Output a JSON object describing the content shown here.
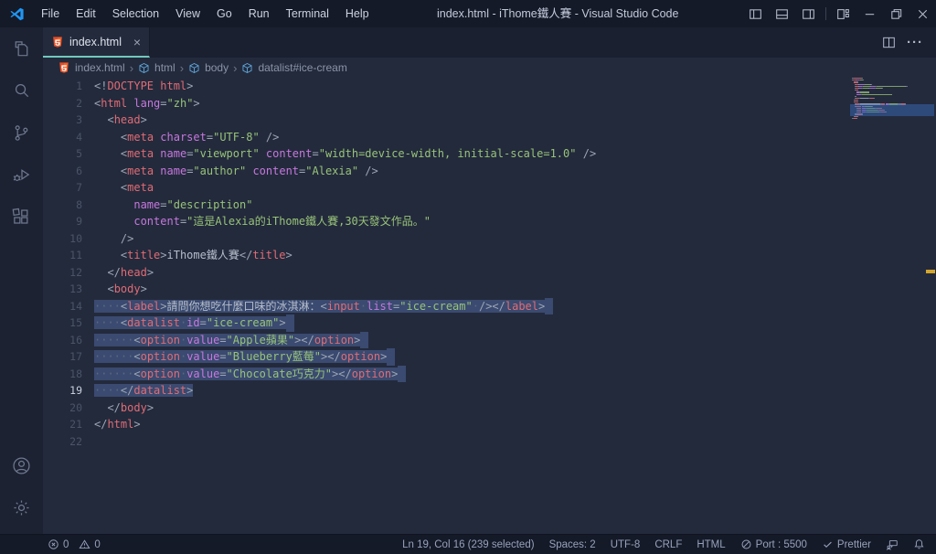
{
  "window": {
    "title": "index.html - iThome鐵人賽 - Visual Studio Code"
  },
  "menubar": {
    "items": [
      "File",
      "Edit",
      "Selection",
      "View",
      "Go",
      "Run",
      "Terminal",
      "Help"
    ]
  },
  "window_controls": [
    "toggle-sidebar-icon",
    "toggle-panel-icon",
    "toggle-secondary-sidebar-icon",
    "customize-layout-icon",
    "minimize-icon",
    "restore-icon",
    "close-icon"
  ],
  "activity_bar": {
    "top": [
      "explorer-icon",
      "search-icon",
      "source-control-icon",
      "run-debug-icon",
      "extensions-icon"
    ],
    "bottom": [
      "account-icon",
      "settings-gear-icon"
    ]
  },
  "tabbar": {
    "tabs": [
      {
        "label": "index.html",
        "icon": "html5-file-icon",
        "close": "×"
      }
    ]
  },
  "editor_actions": {
    "split_icon": "split-editor-icon",
    "more_label": "···"
  },
  "breadcrumb": {
    "separator": "›",
    "items": [
      {
        "label": "index.html",
        "icon": "html5-file-icon"
      },
      {
        "label": "html",
        "icon": "symbol-cube-icon"
      },
      {
        "label": "body",
        "icon": "symbol-cube-icon"
      },
      {
        "label": "datalist#ice-cream",
        "icon": "symbol-cube-icon"
      }
    ]
  },
  "editor": {
    "lines": [
      {
        "n": 1,
        "sel": false,
        "seg": [
          [
            "punc",
            "<!"
          ],
          [
            "tag",
            "DOCTYPE html"
          ],
          [
            "punc",
            ">"
          ]
        ]
      },
      {
        "n": 2,
        "sel": false,
        "seg": [
          [
            "punc",
            "<"
          ],
          [
            "tag",
            "html"
          ],
          [
            "txt",
            " "
          ],
          [
            "attr",
            "lang"
          ],
          [
            "punc",
            "="
          ],
          [
            "str",
            "\"zh\""
          ],
          [
            "punc",
            ">"
          ]
        ]
      },
      {
        "n": 3,
        "sel": false,
        "seg": [
          [
            "ws",
            "  "
          ],
          [
            "punc",
            "<"
          ],
          [
            "tag",
            "head"
          ],
          [
            "punc",
            ">"
          ]
        ]
      },
      {
        "n": 4,
        "sel": false,
        "seg": [
          [
            "ws",
            "    "
          ],
          [
            "punc",
            "<"
          ],
          [
            "tag",
            "meta"
          ],
          [
            "txt",
            " "
          ],
          [
            "attr",
            "charset"
          ],
          [
            "punc",
            "="
          ],
          [
            "str",
            "\"UTF-8\""
          ],
          [
            "txt",
            " "
          ],
          [
            "punc",
            "/>"
          ]
        ]
      },
      {
        "n": 5,
        "sel": false,
        "seg": [
          [
            "ws",
            "    "
          ],
          [
            "punc",
            "<"
          ],
          [
            "tag",
            "meta"
          ],
          [
            "txt",
            " "
          ],
          [
            "attr",
            "name"
          ],
          [
            "punc",
            "="
          ],
          [
            "str",
            "\"viewport\""
          ],
          [
            "txt",
            " "
          ],
          [
            "attr",
            "content"
          ],
          [
            "punc",
            "="
          ],
          [
            "str",
            "\"width=device-width, initial-scale=1.0\""
          ],
          [
            "txt",
            " "
          ],
          [
            "punc",
            "/>"
          ]
        ]
      },
      {
        "n": 6,
        "sel": false,
        "seg": [
          [
            "ws",
            "    "
          ],
          [
            "punc",
            "<"
          ],
          [
            "tag",
            "meta"
          ],
          [
            "txt",
            " "
          ],
          [
            "attr",
            "name"
          ],
          [
            "punc",
            "="
          ],
          [
            "str",
            "\"author\""
          ],
          [
            "txt",
            " "
          ],
          [
            "attr",
            "content"
          ],
          [
            "punc",
            "="
          ],
          [
            "str",
            "\"Alexia\""
          ],
          [
            "txt",
            " "
          ],
          [
            "punc",
            "/>"
          ]
        ]
      },
      {
        "n": 7,
        "sel": false,
        "seg": [
          [
            "ws",
            "    "
          ],
          [
            "punc",
            "<"
          ],
          [
            "tag",
            "meta"
          ]
        ]
      },
      {
        "n": 8,
        "sel": false,
        "seg": [
          [
            "ws",
            "      "
          ],
          [
            "attr",
            "name"
          ],
          [
            "punc",
            "="
          ],
          [
            "str",
            "\"description\""
          ]
        ]
      },
      {
        "n": 9,
        "sel": false,
        "seg": [
          [
            "ws",
            "      "
          ],
          [
            "attr",
            "content"
          ],
          [
            "punc",
            "="
          ],
          [
            "str",
            "\"這是Alexia的iThome鐵人賽,30天發文作品。\""
          ]
        ]
      },
      {
        "n": 10,
        "sel": false,
        "seg": [
          [
            "ws",
            "    "
          ],
          [
            "punc",
            "/>"
          ]
        ]
      },
      {
        "n": 11,
        "sel": false,
        "seg": [
          [
            "ws",
            "    "
          ],
          [
            "punc",
            "<"
          ],
          [
            "tag",
            "title"
          ],
          [
            "punc",
            ">"
          ],
          [
            "txt",
            "iThome鐵人賽"
          ],
          [
            "punc",
            "</"
          ],
          [
            "tag",
            "title"
          ],
          [
            "punc",
            ">"
          ]
        ]
      },
      {
        "n": 12,
        "sel": false,
        "seg": [
          [
            "ws",
            "  "
          ],
          [
            "punc",
            "</"
          ],
          [
            "tag",
            "head"
          ],
          [
            "punc",
            ">"
          ]
        ]
      },
      {
        "n": 13,
        "sel": false,
        "seg": [
          [
            "ws",
            "  "
          ],
          [
            "punc",
            "<"
          ],
          [
            "tag",
            "body"
          ],
          [
            "punc",
            ">"
          ]
        ]
      },
      {
        "n": 14,
        "sel": true,
        "nl": true,
        "seg": [
          [
            "ws",
            "    "
          ],
          [
            "punc",
            "<"
          ],
          [
            "tag",
            "label"
          ],
          [
            "punc",
            ">"
          ],
          [
            "txt",
            "請問你想吃什麼口味的冰淇淋："
          ],
          [
            "punc",
            "<"
          ],
          [
            "tag",
            "input"
          ],
          [
            "ws",
            " "
          ],
          [
            "attr",
            "list"
          ],
          [
            "punc",
            "="
          ],
          [
            "str",
            "\"ice-cream\""
          ],
          [
            "ws",
            " "
          ],
          [
            "punc",
            "/>"
          ],
          [
            "punc",
            "</"
          ],
          [
            "tag",
            "label"
          ],
          [
            "punc",
            ">"
          ]
        ]
      },
      {
        "n": 15,
        "sel": true,
        "nl": true,
        "seg": [
          [
            "ws",
            "    "
          ],
          [
            "punc",
            "<"
          ],
          [
            "tag",
            "datalist"
          ],
          [
            "ws",
            " "
          ],
          [
            "attr",
            "id"
          ],
          [
            "punc",
            "="
          ],
          [
            "str",
            "\"ice-cream\""
          ],
          [
            "punc",
            ">"
          ]
        ]
      },
      {
        "n": 16,
        "sel": true,
        "nl": true,
        "seg": [
          [
            "ws",
            "      "
          ],
          [
            "punc",
            "<"
          ],
          [
            "tag",
            "option"
          ],
          [
            "ws",
            " "
          ],
          [
            "attr",
            "value"
          ],
          [
            "punc",
            "="
          ],
          [
            "str",
            "\"Apple蘋果\""
          ],
          [
            "punc",
            ">"
          ],
          [
            "punc",
            "</"
          ],
          [
            "tag",
            "option"
          ],
          [
            "punc",
            ">"
          ]
        ]
      },
      {
        "n": 17,
        "sel": true,
        "nl": true,
        "seg": [
          [
            "ws",
            "      "
          ],
          [
            "punc",
            "<"
          ],
          [
            "tag",
            "option"
          ],
          [
            "ws",
            " "
          ],
          [
            "attr",
            "value"
          ],
          [
            "punc",
            "="
          ],
          [
            "str",
            "\"Blueberry藍莓\""
          ],
          [
            "punc",
            ">"
          ],
          [
            "punc",
            "</"
          ],
          [
            "tag",
            "option"
          ],
          [
            "punc",
            ">"
          ]
        ]
      },
      {
        "n": 18,
        "sel": true,
        "nl": true,
        "seg": [
          [
            "ws",
            "      "
          ],
          [
            "punc",
            "<"
          ],
          [
            "tag",
            "option"
          ],
          [
            "ws",
            " "
          ],
          [
            "attr",
            "value"
          ],
          [
            "punc",
            "="
          ],
          [
            "str",
            "\"Chocolate巧克力\""
          ],
          [
            "punc",
            ">"
          ],
          [
            "punc",
            "</"
          ],
          [
            "tag",
            "option"
          ],
          [
            "punc",
            ">"
          ]
        ]
      },
      {
        "n": 19,
        "sel": true,
        "cur": true,
        "seg": [
          [
            "ws",
            "    "
          ],
          [
            "punc",
            "</"
          ],
          [
            "tag",
            "datalist"
          ],
          [
            "punc",
            ">"
          ]
        ]
      },
      {
        "n": 20,
        "sel": false,
        "seg": [
          [
            "ws",
            "  "
          ],
          [
            "punc",
            "</"
          ],
          [
            "tag",
            "body"
          ],
          [
            "punc",
            ">"
          ]
        ]
      },
      {
        "n": 21,
        "sel": false,
        "seg": [
          [
            "punc",
            "</"
          ],
          [
            "tag",
            "html"
          ],
          [
            "punc",
            ">"
          ]
        ]
      },
      {
        "n": 22,
        "sel": false,
        "seg": []
      }
    ]
  },
  "statusbar": {
    "left": [
      {
        "name": "status-errors",
        "icon": "error-icon",
        "text": "0"
      },
      {
        "name": "status-warnings",
        "icon": "warning-icon",
        "text": "0"
      }
    ],
    "right": [
      {
        "name": "status-cursor-position",
        "text": "Ln 19, Col 16 (239 selected)"
      },
      {
        "name": "status-indentation",
        "text": "Spaces: 2"
      },
      {
        "name": "status-encoding",
        "text": "UTF-8"
      },
      {
        "name": "status-eol",
        "text": "CRLF"
      },
      {
        "name": "status-language",
        "text": "HTML"
      },
      {
        "name": "status-live-server-port",
        "icon": "port-icon",
        "text": "Port : 5500"
      },
      {
        "name": "status-prettier",
        "icon": "check-icon",
        "text": "Prettier"
      },
      {
        "name": "status-feedback",
        "icon": "feedback-icon",
        "text": ""
      },
      {
        "name": "status-notifications",
        "icon": "bell-icon",
        "text": ""
      }
    ]
  },
  "colors": {
    "accent_tab_underline": "#72c8bd",
    "selection": "#3a4a70",
    "tag": "#e06c75",
    "attribute": "#c678dd",
    "string": "#98c379",
    "punctuation": "#9da5b4",
    "plain_text": "#b6bdca",
    "html5_orange": "#e44d26",
    "symbol_blue": "#5fa8dc",
    "overview_marker": "#d4a72c",
    "logo_blue": "#2196f3"
  }
}
